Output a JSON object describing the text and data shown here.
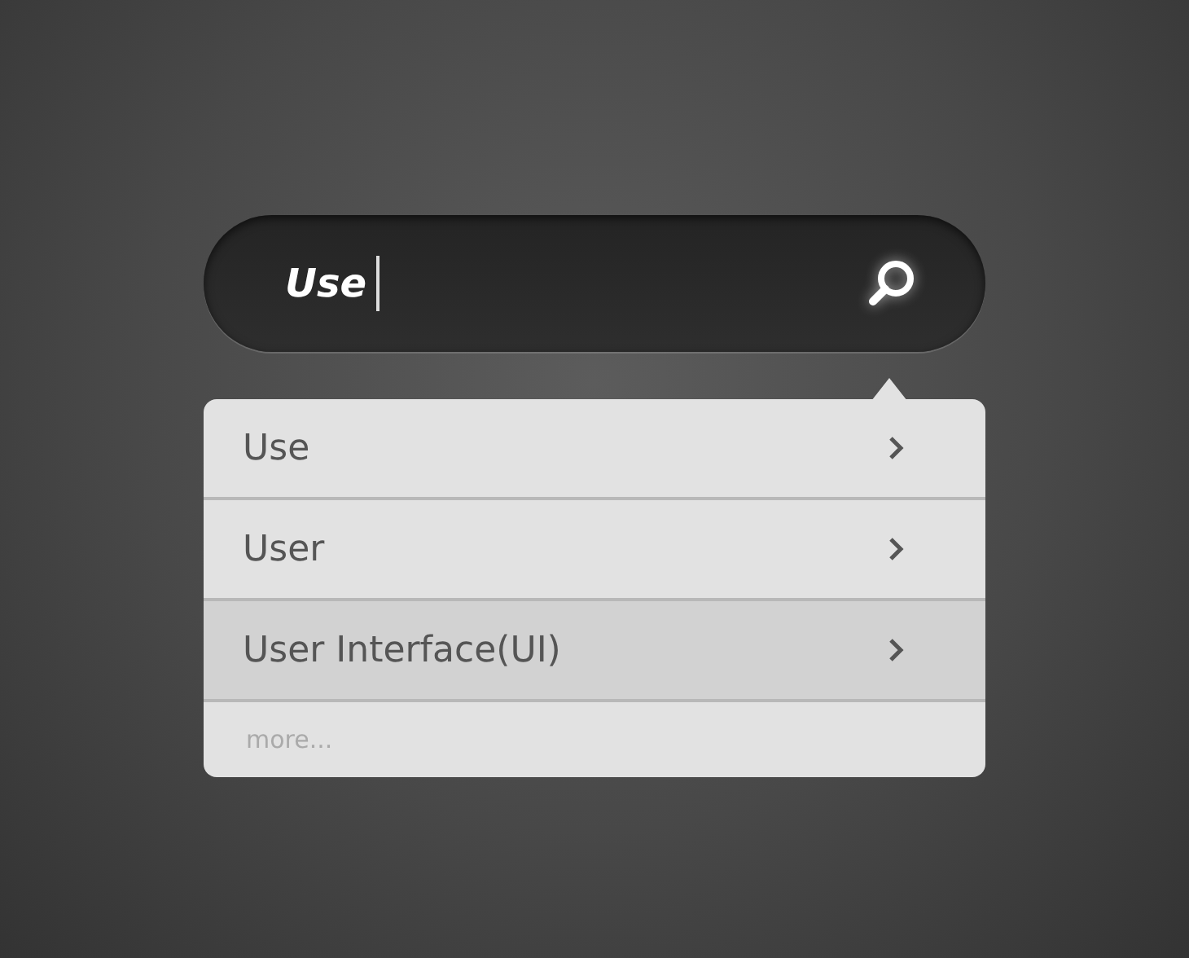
{
  "search": {
    "value": "Use"
  },
  "suggestions": [
    {
      "label": "Use",
      "selected": false
    },
    {
      "label": "User",
      "selected": false
    },
    {
      "label": "User Interface(UI)",
      "selected": true
    }
  ],
  "more": "more..."
}
